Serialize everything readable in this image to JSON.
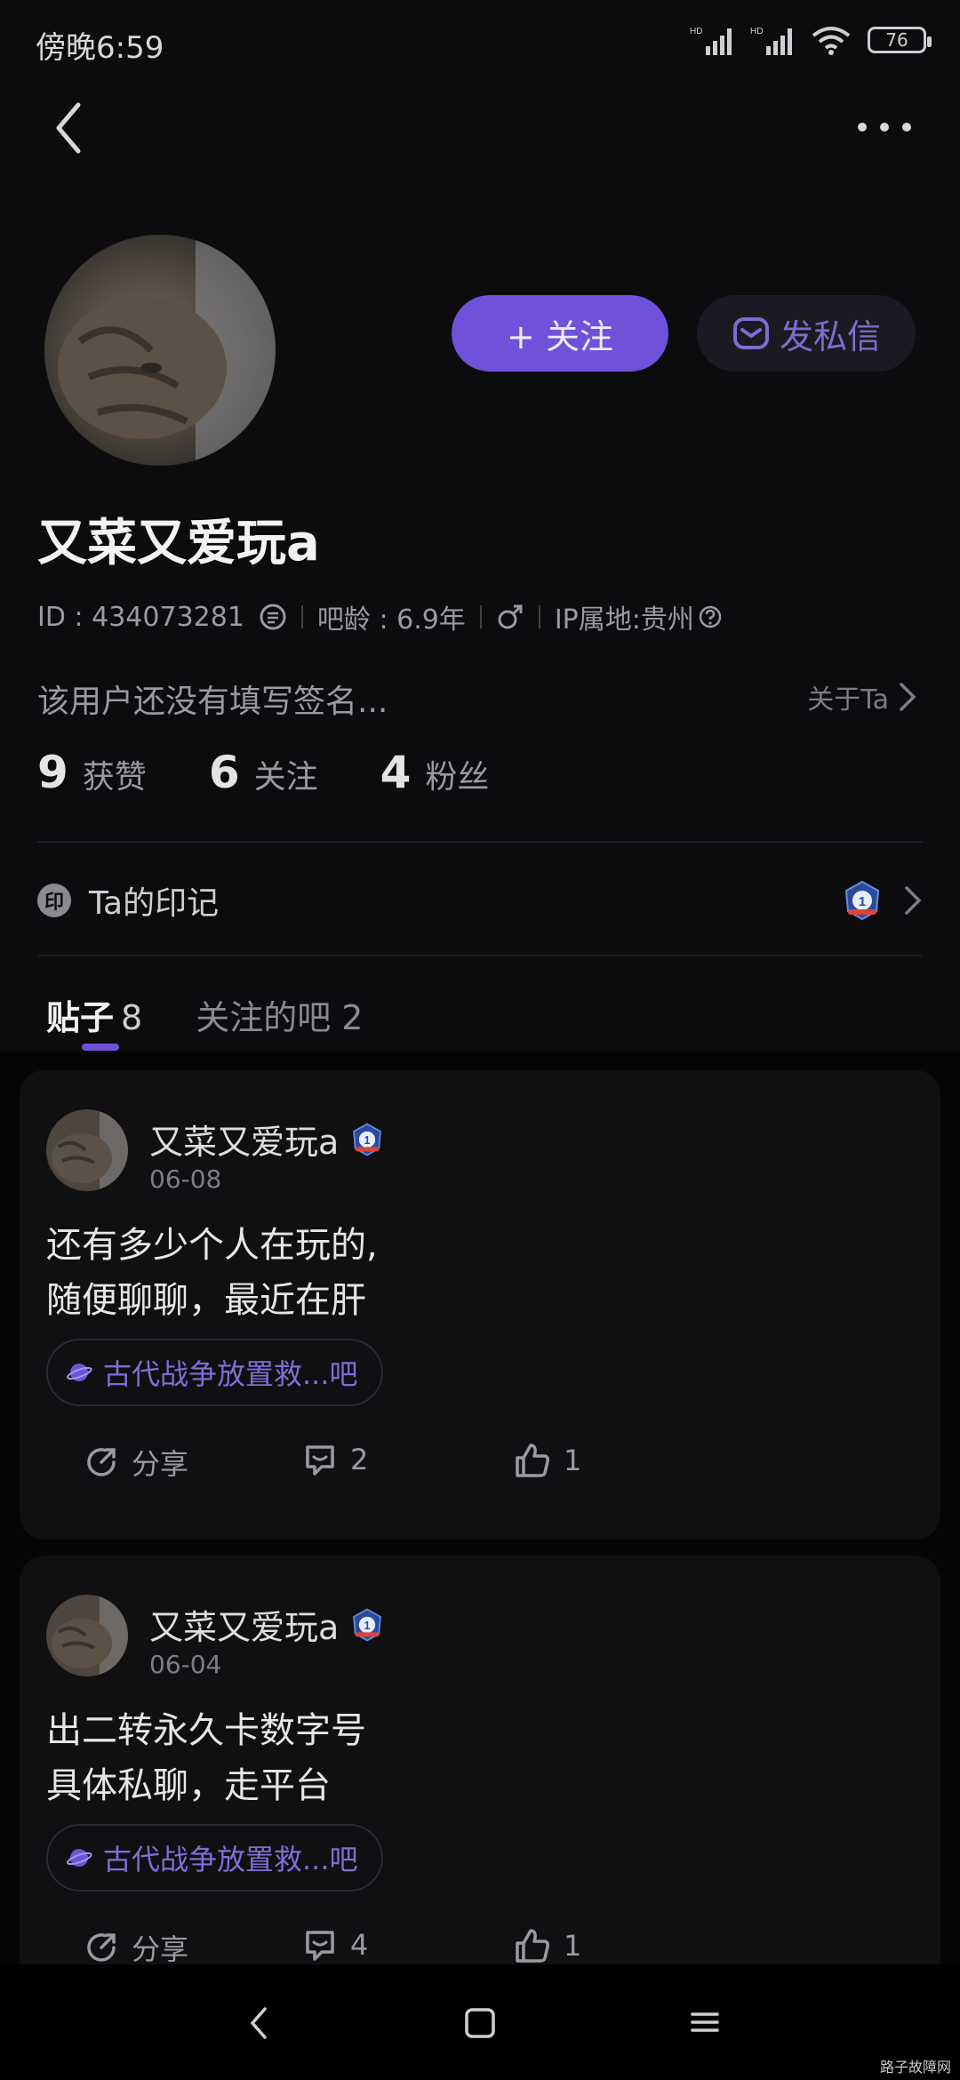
{
  "status_bar": {
    "time": "傍晚6:59",
    "battery": "76"
  },
  "profile": {
    "username": "又菜又爱玩a",
    "id_text": "ID : 434073281",
    "age_text": "吧龄 : 6.9年",
    "ip_text": "IP属地:贵州",
    "signature": "该用户还没有填写签名...",
    "about_label": "关于Ta",
    "follow_button": "+ 关注",
    "message_button": "发私信"
  },
  "stats": [
    {
      "num": "9",
      "label": "获赞"
    },
    {
      "num": "6",
      "label": "关注"
    },
    {
      "num": "4",
      "label": "粉丝"
    }
  ],
  "marks": {
    "badge_char": "印",
    "label": "Ta的印记"
  },
  "tabs": {
    "posts_label": "贴子",
    "posts_count": "8",
    "bars_label": "关注的吧 2"
  },
  "posts": [
    {
      "author": "又菜又爱玩a",
      "date": "06-08",
      "line1": "还有多少个人在玩的,",
      "line2": "随便聊聊，最近在肝",
      "tag": "古代战争放置救...吧",
      "share": "分享",
      "comments": "2",
      "likes": "1"
    },
    {
      "author": "又菜又爱玩a",
      "date": "06-04",
      "line1": "出二转永久卡数字号",
      "line2": "具体私聊，走平台",
      "tag": "古代战争放置救...吧",
      "share": "分享",
      "comments": "4",
      "likes": "1"
    }
  ],
  "watermark": "路子故障网",
  "colors": {
    "accent": "#6f52d9",
    "background": "#0c0c0e",
    "card": "#101012"
  }
}
